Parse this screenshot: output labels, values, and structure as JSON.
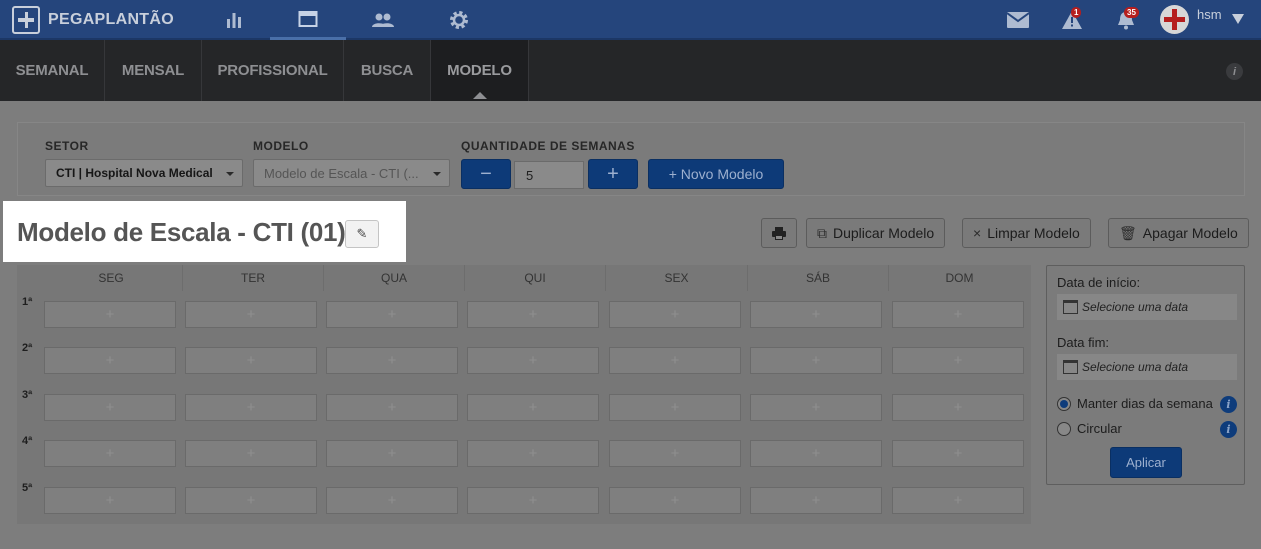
{
  "brand": {
    "name": "PEGAPLANTÃO"
  },
  "topnav": {
    "icons": [
      "bar-chart-icon",
      "calendar-icon",
      "users-icon",
      "gear-icon"
    ],
    "mail_icon": "mail-icon",
    "alert_badge": "1",
    "notification_badge": "35",
    "user_name": "hsm"
  },
  "tabs": [
    {
      "label": "SEMANAL"
    },
    {
      "label": "MENSAL"
    },
    {
      "label": "PROFISSIONAL"
    },
    {
      "label": "BUSCA"
    },
    {
      "label": "MODELO"
    }
  ],
  "info_label": "i",
  "filters": {
    "setor_label": "SETOR",
    "setor_value": "CTI | Hospital Nova Medical",
    "modelo_label": "MODELO",
    "modelo_value": "Modelo de Escala - CTI (...",
    "qtd_label": "QUANTIDADE DE SEMANAS",
    "qtd_minus": "−",
    "qtd_value": "5",
    "qtd_plus": "+",
    "novo_modelo": "+ Novo Modelo"
  },
  "title": "Modelo de Escala - CTI (01)",
  "actions": {
    "print_icon": "printer-icon",
    "duplicar": "Duplicar Modelo",
    "limpar": "Limpar Modelo",
    "apagar": "Apagar Modelo"
  },
  "grid": {
    "days": [
      "SEG",
      "TER",
      "QUA",
      "QUI",
      "SEX",
      "SÁB",
      "DOM"
    ],
    "weeks": [
      "1ª",
      "2ª",
      "3ª",
      "4ª",
      "5ª"
    ],
    "cell_placeholder": "+"
  },
  "panel": {
    "data_inicio_label": "Data de início:",
    "data_inicio_placeholder": "Selecione uma data",
    "data_fim_label": "Data fim:",
    "data_fim_placeholder": "Selecione uma data",
    "option_manter": "Manter dias da semana",
    "option_circular": "Circular",
    "selected_option": "manter",
    "aplicar": "Aplicar"
  }
}
